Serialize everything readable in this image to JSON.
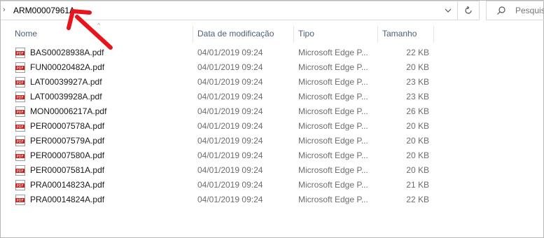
{
  "address_bar": {
    "path": "ARM00007961A"
  },
  "search": {
    "placeholder": "Pesquis"
  },
  "columns": {
    "name": "Nome",
    "date": "Data de modificação",
    "type": "Tipo",
    "size": "Tamanho"
  },
  "files": [
    {
      "name": "BAS00028938A.pdf",
      "date": "04/01/2019 09:24",
      "type": "Microsoft Edge P...",
      "size": "22 KB"
    },
    {
      "name": "FUN00020482A.pdf",
      "date": "04/01/2019 09:24",
      "type": "Microsoft Edge P...",
      "size": "20 KB"
    },
    {
      "name": "LAT00039927A.pdf",
      "date": "04/01/2019 09:24",
      "type": "Microsoft Edge P...",
      "size": "23 KB"
    },
    {
      "name": "LAT00039928A.pdf",
      "date": "04/01/2019 09:24",
      "type": "Microsoft Edge P...",
      "size": "23 KB"
    },
    {
      "name": "MON00006217A.pdf",
      "date": "04/01/2019 09:24",
      "type": "Microsoft Edge P...",
      "size": "26 KB"
    },
    {
      "name": "PER00007578A.pdf",
      "date": "04/01/2019 09:24",
      "type": "Microsoft Edge P...",
      "size": "20 KB"
    },
    {
      "name": "PER00007579A.pdf",
      "date": "04/01/2019 09:24",
      "type": "Microsoft Edge P...",
      "size": "20 KB"
    },
    {
      "name": "PER00007580A.pdf",
      "date": "04/01/2019 09:24",
      "type": "Microsoft Edge P...",
      "size": "20 KB"
    },
    {
      "name": "PER00007581A.pdf",
      "date": "04/01/2019 09:24",
      "type": "Microsoft Edge P...",
      "size": "20 KB"
    },
    {
      "name": "PRA00014823A.pdf",
      "date": "04/01/2019 09:24",
      "type": "Microsoft Edge P...",
      "size": "21 KB"
    },
    {
      "name": "PRA00014824A.pdf",
      "date": "04/01/2019 09:24",
      "type": "Microsoft Edge P...",
      "size": "22 KB"
    }
  ],
  "icons": {
    "file": "pdf-file-icon",
    "refresh": "refresh-icon",
    "search": "search-icon",
    "dropdown": "chevron-down-icon",
    "annotation": "red-arrow-icon"
  },
  "colors": {
    "annotation_arrow": "#e8141c",
    "pdf_icon": "#c8201c",
    "header_text": "#4c607a"
  }
}
